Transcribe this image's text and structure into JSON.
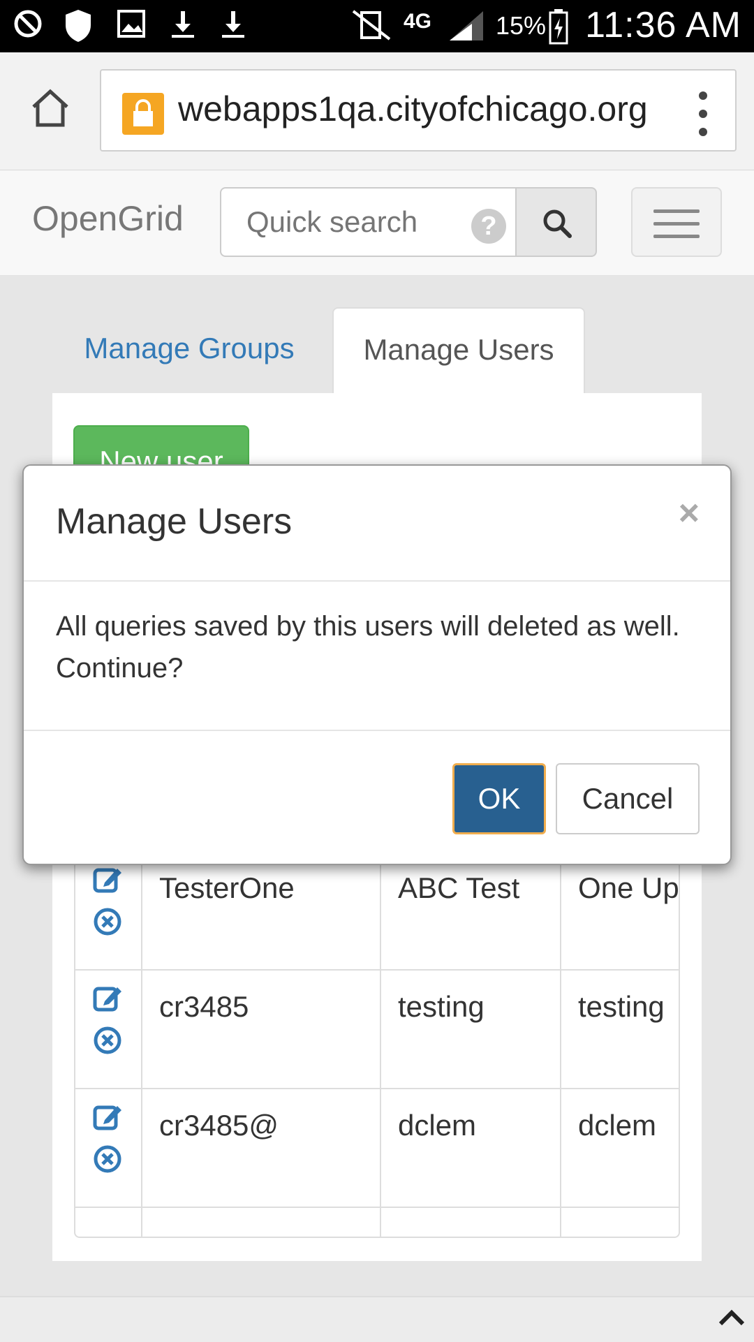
{
  "status_bar": {
    "time": "11:36 AM",
    "battery": "15%",
    "network": "4G"
  },
  "browser": {
    "url": "webapps1qa.cityofchicago.org"
  },
  "navbar": {
    "brand": "OpenGrid",
    "search_placeholder": "Quick search",
    "help_label": "?"
  },
  "tabs": [
    {
      "label": "Manage Groups"
    },
    {
      "label": "Manage Users"
    }
  ],
  "panel": {
    "new_user_label": "New user"
  },
  "table": {
    "rows": [
      {
        "c1": "TesterOne",
        "c2": "ABC Test",
        "c3": "One Upd"
      },
      {
        "c1": "cr3485",
        "c2": "testing",
        "c3": "testing"
      },
      {
        "c1": "cr3485@",
        "c2": "dclem",
        "c3": "dclem"
      }
    ]
  },
  "modal": {
    "title": "Manage Users",
    "close": "×",
    "message": "All queries saved by this users will deleted as well. Continue?",
    "ok_label": "OK",
    "cancel_label": "Cancel"
  },
  "colors": {
    "link": "#337ab7",
    "success": "#5cb85c",
    "primary": "#286090",
    "focus_ring": "#f0ad4e"
  }
}
